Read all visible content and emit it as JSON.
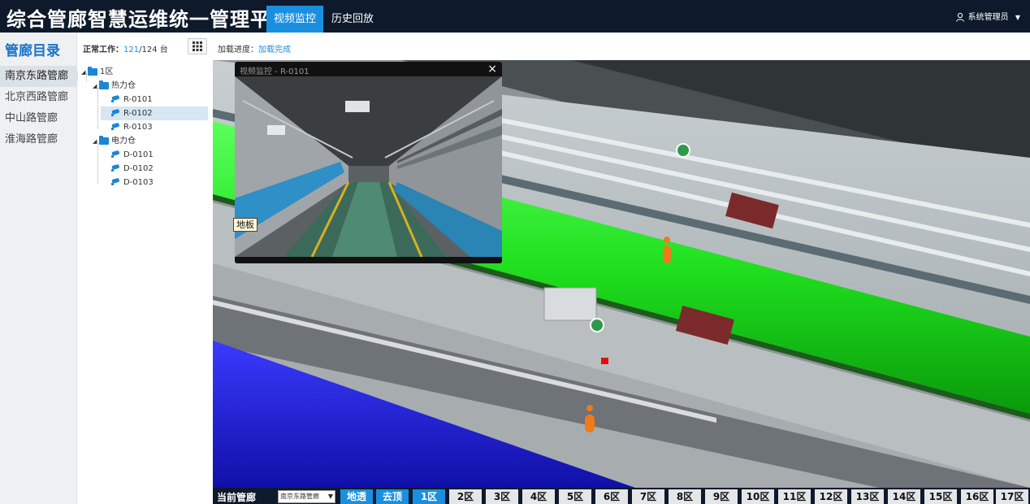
{
  "header": {
    "app_title": "综合管廊智慧运维统一管理平台",
    "tabs": [
      {
        "label": "视频监控",
        "active": true
      },
      {
        "label": "历史回放",
        "active": false
      }
    ],
    "user": "系统管理员",
    "accent_color": "#1a8fe0"
  },
  "sidebar": {
    "title": "管廊目录",
    "items": [
      {
        "label": "南京东路管廊",
        "active": true
      },
      {
        "label": "北京西路管廊",
        "active": false
      },
      {
        "label": "中山路管廊",
        "active": false
      },
      {
        "label": "淮海路管廊",
        "active": false
      }
    ]
  },
  "tree_panel": {
    "status_label": "正常工作：",
    "working": "121",
    "total": "/124 台",
    "nodes": [
      {
        "label": "1区",
        "type": "folder"
      },
      {
        "label": "热力仓",
        "type": "folder"
      },
      {
        "label": "R-0101",
        "type": "camera"
      },
      {
        "label": "R-0102",
        "type": "camera",
        "selected": true
      },
      {
        "label": "R-0103",
        "type": "camera"
      },
      {
        "label": "电力仓",
        "type": "folder"
      },
      {
        "label": "D-0101",
        "type": "camera"
      },
      {
        "label": "D-0102",
        "type": "camera"
      },
      {
        "label": "D-0103",
        "type": "camera"
      }
    ]
  },
  "loading": {
    "label": "加载进度：",
    "status": "加载完成"
  },
  "video_popup": {
    "title": "视频监控 - R-0101",
    "close": "×"
  },
  "floor_label": "地板",
  "bottom_bar": {
    "current_label": "当前管廊",
    "select_value": "南京东路管廊",
    "buttons": [
      "地透",
      "去顶",
      "1区",
      "2区",
      "3区",
      "4区",
      "5区",
      "6区",
      "7区",
      "8区",
      "9区",
      "10区",
      "11区",
      "12区",
      "13区",
      "14区",
      "15区",
      "16区",
      "17区"
    ],
    "highlighted": [
      "地透",
      "去顶",
      "1区"
    ]
  }
}
